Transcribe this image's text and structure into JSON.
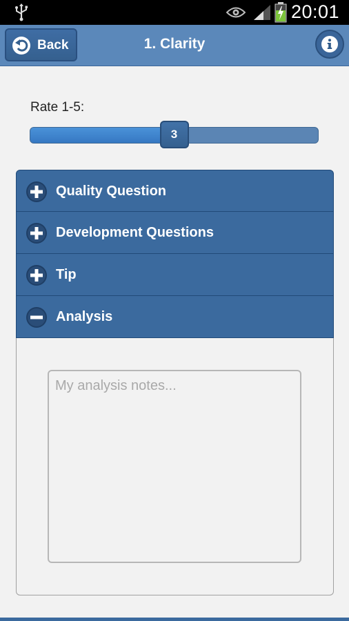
{
  "status_bar": {
    "time": "20:01",
    "icons": [
      "usb-icon",
      "eye-icon",
      "signal-icon",
      "battery-charging-icon"
    ]
  },
  "header": {
    "back_label": "Back",
    "title": "1. Clarity",
    "info_icon": "info-icon"
  },
  "rating": {
    "label": "Rate 1-5:",
    "value": "3",
    "min": 1,
    "max": 5
  },
  "accordion": {
    "items": [
      {
        "label": "Quality Question",
        "state": "collapsed",
        "icon": "plus-icon"
      },
      {
        "label": "Development Questions",
        "state": "collapsed",
        "icon": "plus-icon"
      },
      {
        "label": "Tip",
        "state": "collapsed",
        "icon": "plus-icon"
      },
      {
        "label": "Analysis",
        "state": "expanded",
        "icon": "minus-icon"
      }
    ]
  },
  "analysis": {
    "notes_value": "",
    "notes_placeholder": "My analysis notes..."
  },
  "colors": {
    "header_bg": "#5b88ba",
    "accent": "#3b6a9e",
    "slider_fill": "#3678c2"
  }
}
